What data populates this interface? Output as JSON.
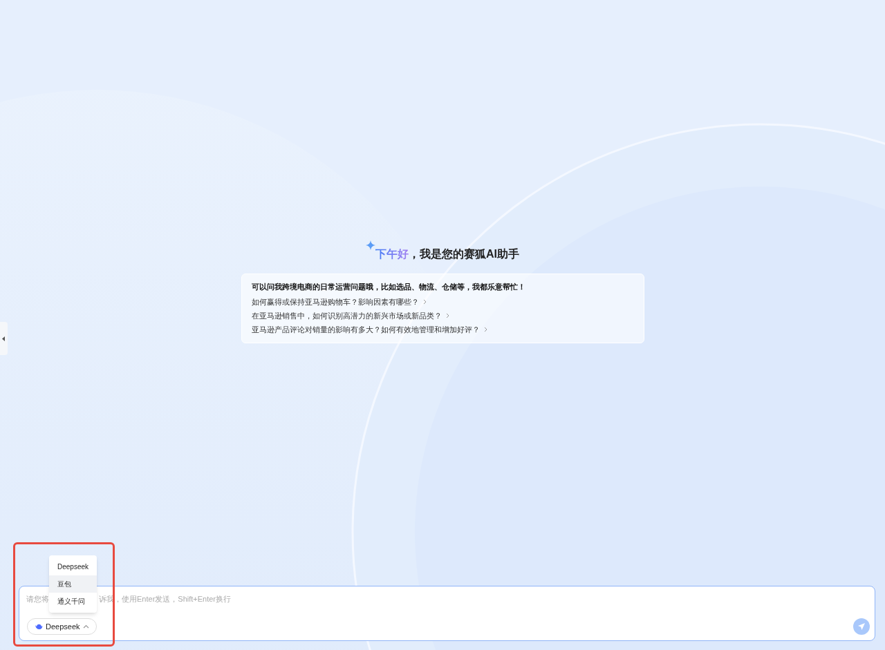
{
  "greeting": {
    "highlight": "下午好",
    "rest": "，我是您的赛狐AI助手"
  },
  "suggestions": {
    "intro": "可以问我跨境电商的日常运营问题哦，比如选品、物流、仓储等，我都乐意帮忙！",
    "items": [
      "如何赢得或保持亚马逊购物车？影响因素有哪些？",
      "在亚马逊销售中，如何识别高潜力的新兴市场或新品类？",
      "亚马逊产品评论对销量的影响有多大？如何有效地管理和增加好评？"
    ]
  },
  "input": {
    "placeholder_parts": [
      "请您将",
      "诉我，使用Enter发送，Shift+Enter换行"
    ]
  },
  "model_menu": {
    "expanded": true,
    "items": [
      {
        "label": "Deepseek",
        "selected": false
      },
      {
        "label": "豆包",
        "selected": true
      },
      {
        "label": "通义千问",
        "selected": false
      }
    ]
  },
  "model_button": {
    "label": "Deepseek"
  }
}
